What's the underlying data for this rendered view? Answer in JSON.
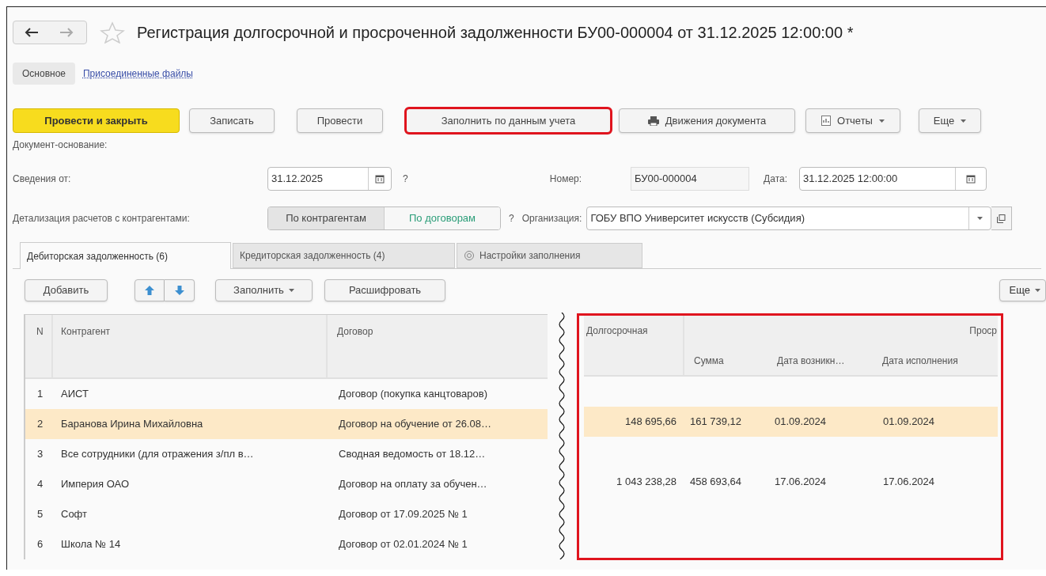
{
  "window": {
    "title": "Регистрация долгосрочной и просроченной задолженности БУ00-000004 от 31.12.2025 12:00:00 *"
  },
  "form_tabs": [
    {
      "label": "Основное",
      "selected": true
    },
    {
      "label": "Присоединенные файлы",
      "selected": false
    }
  ],
  "toolbar": [
    {
      "label": "Провести и закрыть",
      "kind": "primary",
      "dropdown": false,
      "highlighted": false
    },
    {
      "label": "Записать",
      "kind": "plain",
      "dropdown": false,
      "highlighted": false
    },
    {
      "label": "Провести",
      "kind": "plain",
      "dropdown": false,
      "highlighted": false
    },
    {
      "label": "Заполнить по данным учета",
      "kind": "plain",
      "dropdown": false,
      "highlighted": true
    },
    {
      "label": "Движения документа",
      "kind": "icon",
      "dropdown": false,
      "highlighted": false
    },
    {
      "label": "Отчеты",
      "kind": "icon",
      "dropdown": true,
      "highlighted": false
    },
    {
      "label": "Еще",
      "kind": "plain",
      "dropdown": true,
      "highlighted": false
    }
  ],
  "basis_label": "Документ-основание:",
  "info_date": {
    "label": "Сведения от:",
    "value": "31.12.2025",
    "help": "?"
  },
  "number": {
    "label": "Номер:",
    "value": "БУ00-000004"
  },
  "date": {
    "label": "Дата:",
    "value": "31.12.2025 12:00:00"
  },
  "detail": {
    "label": "Детализация расчетов с контрагентами:",
    "help": "?",
    "options": [
      {
        "label": "По контрагентам",
        "selected": true
      },
      {
        "label": "По договорам",
        "selected": false
      }
    ]
  },
  "organization": {
    "label": "Организация:",
    "value": "ГОБУ ВПО Университет искусств (Субсидия)"
  },
  "tabs": [
    {
      "label": "Дебиторская задолженность (6)",
      "selected": true,
      "kind": "plain"
    },
    {
      "label": "Кредиторская задолженность (4)",
      "selected": false,
      "kind": "plain"
    },
    {
      "label": "Настройки заполнения",
      "selected": false,
      "kind": "icon"
    }
  ],
  "table_toolbar": [
    {
      "label": "Добавить",
      "kind": "plain",
      "dropdown": false
    },
    {
      "kind": "move_up"
    },
    {
      "kind": "move_down"
    },
    {
      "label": "Заполнить",
      "kind": "plain",
      "dropdown": true
    },
    {
      "label": "Расшифровать",
      "kind": "plain",
      "dropdown": false
    }
  ],
  "table_more": {
    "label": "Еще",
    "dropdown": true
  },
  "table": {
    "columns": [
      "N",
      "Контрагент",
      "Договор"
    ],
    "right_groups": [
      "Долгосрочная",
      "Проср"
    ],
    "right_columns": [
      "Сумма",
      "Дата возникн…",
      "Дата исполнения"
    ],
    "highlighted": true,
    "rows": [
      {
        "n": "1",
        "counterparty": "АИСТ",
        "contract": "Договор (покупка канцтоваров)",
        "selected": false
      },
      {
        "n": "2",
        "counterparty": "Баранова Ирина Михайловна",
        "contract": "Договор на обучение от 26.08…",
        "long_term": "148 695,66",
        "overdue_sum": "161 739,12",
        "overdue_start": "01.09.2024",
        "overdue_due": "01.09.2024",
        "selected": true
      },
      {
        "n": "3",
        "counterparty": "Все сотрудники (для отражения з/пл в…",
        "contract": "Сводная ведомость от 18.12…",
        "selected": false
      },
      {
        "n": "4",
        "counterparty": "Империя ОАО",
        "contract": "Договор на оплату за обучен…",
        "long_term": "1 043 238,28",
        "overdue_sum": "458 693,64",
        "overdue_start": "17.06.2024",
        "overdue_due": "17.06.2024",
        "selected": false
      },
      {
        "n": "5",
        "counterparty": "Софт",
        "contract": "Договор от 17.09.2025 № 1",
        "selected": false
      },
      {
        "n": "6",
        "counterparty": "Школа № 14",
        "contract": "Договор от 02.01.2024 № 1",
        "selected": false
      }
    ]
  }
}
